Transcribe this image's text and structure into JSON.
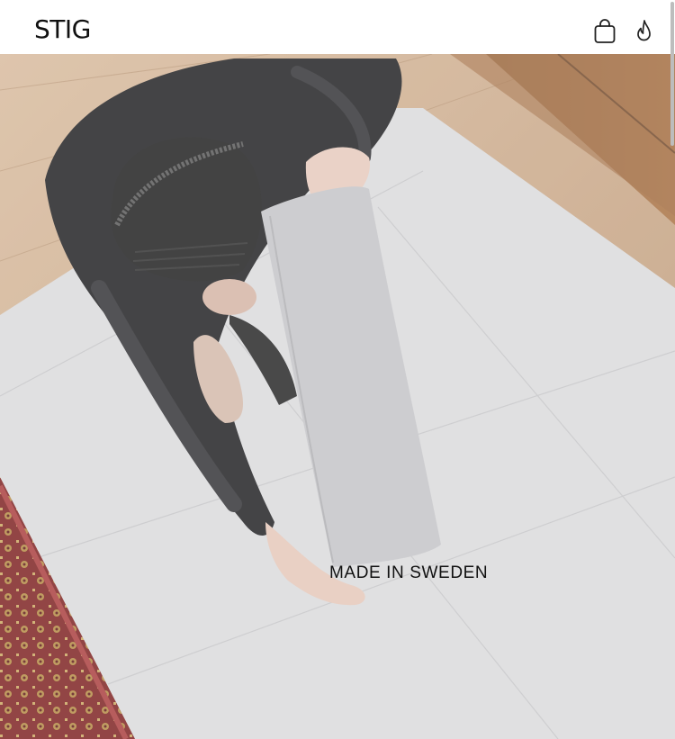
{
  "header": {
    "logo": "STIG",
    "icons": {
      "cart": "shopping-bag-icon",
      "flame": "flame-icon"
    }
  },
  "hero": {
    "caption": "MADE IN SWEDEN",
    "image_alt": "Person in black jacket and beanie folding a light grey fabric on a large white paper sheet on a wooden floor, red patterned rug at bottom left"
  },
  "colors": {
    "text": "#111111",
    "header_bg": "#ffffff",
    "overlay": "#cfcfd0"
  }
}
